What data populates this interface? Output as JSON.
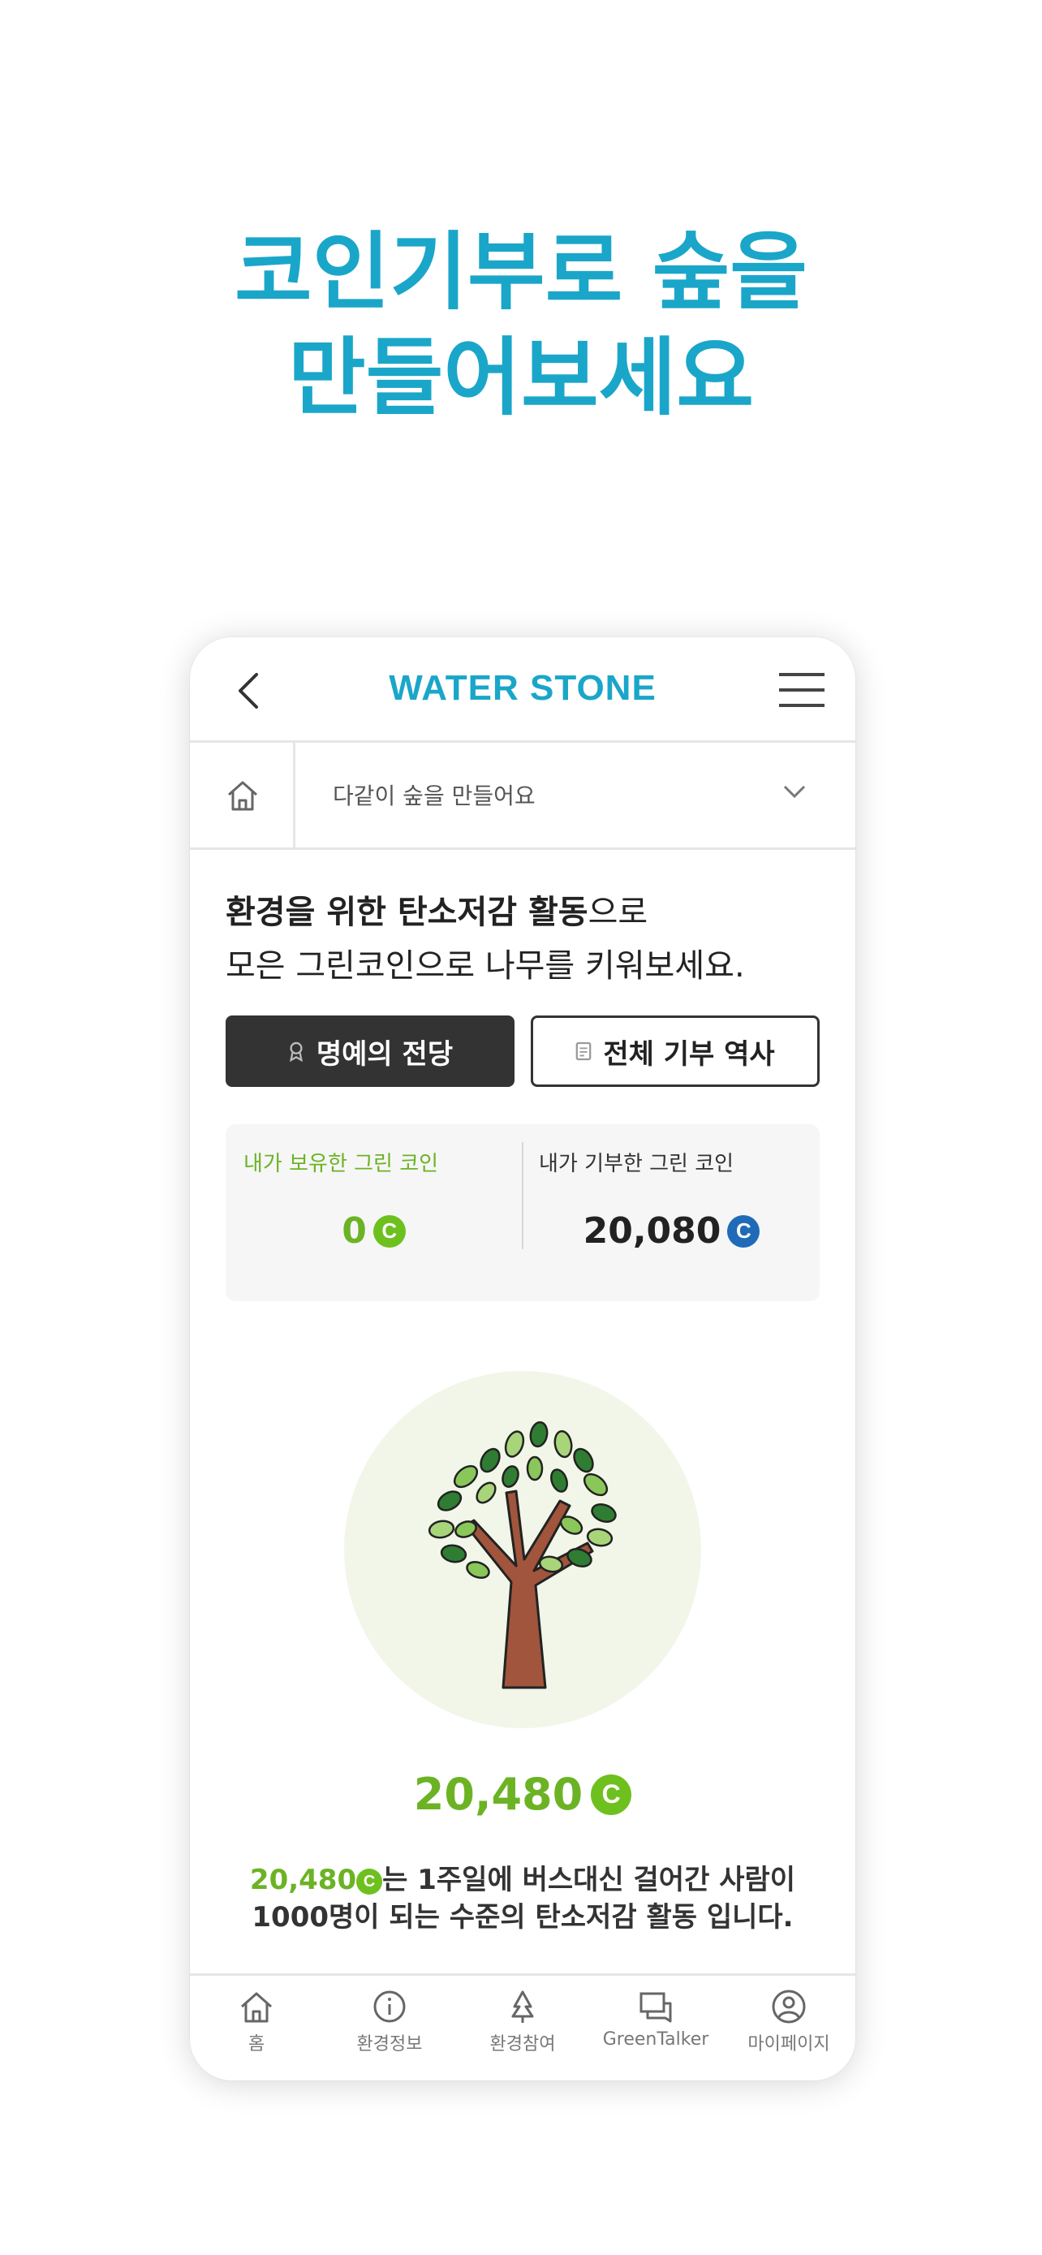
{
  "headline": {
    "line1": "코인기부로 숲을",
    "line2": "만들어보세요"
  },
  "appbar": {
    "brand": "WATER STONE"
  },
  "navrow": {
    "breadcrumb": "다같이 숲을 만들어요"
  },
  "intro": {
    "line1_bold": "환경을 위한 탄소저감 활동",
    "line1_rest": "으로",
    "line2": "모은 그린코인으로 나무를 키워보세요."
  },
  "buttons": {
    "hall_of_fame": "명예의 전당",
    "donation_history": "전체 기부 역사"
  },
  "coins": {
    "held_label": "내가 보유한 그린 코인",
    "held_value": "0",
    "donated_label": "내가 기부한 그린 코인",
    "donated_value": "20,080",
    "coin_symbol": "C"
  },
  "tree": {
    "total": "20,480"
  },
  "description": {
    "amount": "20,480",
    "text1": "는 1주일에 버스대신 걸어간 사람이",
    "count": "1000명",
    "text2": "이 되는 수준의 탄소저감 활동 입니다."
  },
  "tabbar": {
    "items": [
      {
        "label": "홈",
        "icon": "home-icon"
      },
      {
        "label": "환경정보",
        "icon": "info-icon"
      },
      {
        "label": "환경참여",
        "icon": "tree-icon"
      },
      {
        "label": "GreenTalker",
        "icon": "chat-icon"
      },
      {
        "label": "마이페이지",
        "icon": "user-icon"
      }
    ]
  },
  "colors": {
    "accent": "#1aa6c9",
    "green": "#6bb324",
    "coin_blue": "#1f6bb8",
    "dark_button": "#333333"
  }
}
